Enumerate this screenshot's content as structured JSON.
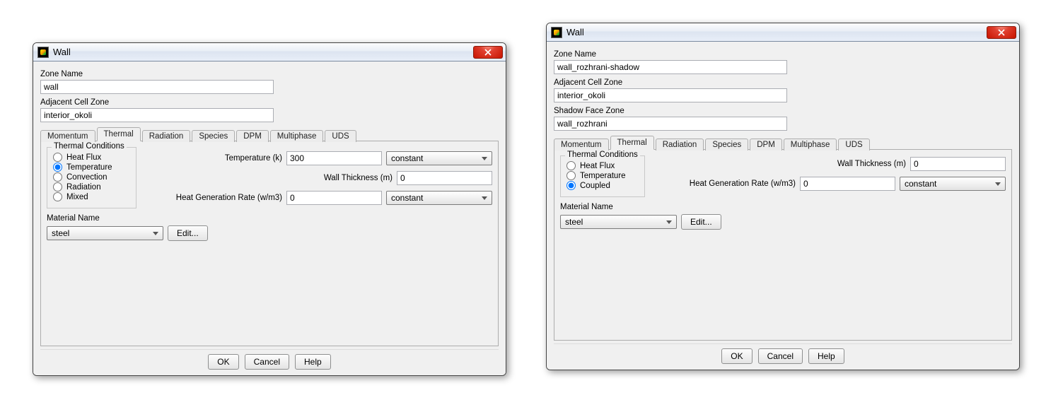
{
  "dialog1": {
    "title": "Wall",
    "zone_name_label": "Zone Name",
    "zone_name": "wall",
    "adj_label": "Adjacent Cell Zone",
    "adj_value": "interior_okoli",
    "tabs": [
      "Momentum",
      "Thermal",
      "Radiation",
      "Species",
      "DPM",
      "Multiphase",
      "UDS"
    ],
    "active_tab": "Thermal",
    "thermal_legend": "Thermal Conditions",
    "radios": [
      "Heat Flux",
      "Temperature",
      "Convection",
      "Radiation",
      "Mixed"
    ],
    "radio_selected": "Temperature",
    "temp_label": "Temperature (k)",
    "temp_value": "300",
    "temp_dd": "constant",
    "thick_label": "Wall Thickness (m)",
    "thick_value": "0",
    "hgr_label": "Heat Generation Rate (w/m3)",
    "hgr_value": "0",
    "hgr_dd": "constant",
    "mat_label": "Material Name",
    "mat_value": "steel",
    "edit_label": "Edit...",
    "ok": "OK",
    "cancel": "Cancel",
    "help": "Help"
  },
  "dialog2": {
    "title": "Wall",
    "zone_name_label": "Zone Name",
    "zone_name": "wall_rozhrani-shadow",
    "adj_label": "Adjacent Cell Zone",
    "adj_value": "interior_okoli",
    "shadow_label": "Shadow Face Zone",
    "shadow_value": "wall_rozhrani",
    "tabs": [
      "Momentum",
      "Thermal",
      "Radiation",
      "Species",
      "DPM",
      "Multiphase",
      "UDS"
    ],
    "active_tab": "Thermal",
    "thermal_legend": "Thermal Conditions",
    "radios": [
      "Heat Flux",
      "Temperature",
      "Coupled"
    ],
    "radio_selected": "Coupled",
    "thick_label": "Wall Thickness (m)",
    "thick_value": "0",
    "hgr_label": "Heat Generation Rate (w/m3)",
    "hgr_value": "0",
    "hgr_dd": "constant",
    "mat_label": "Material Name",
    "mat_value": "steel",
    "edit_label": "Edit...",
    "ok": "OK",
    "cancel": "Cancel",
    "help": "Help"
  }
}
